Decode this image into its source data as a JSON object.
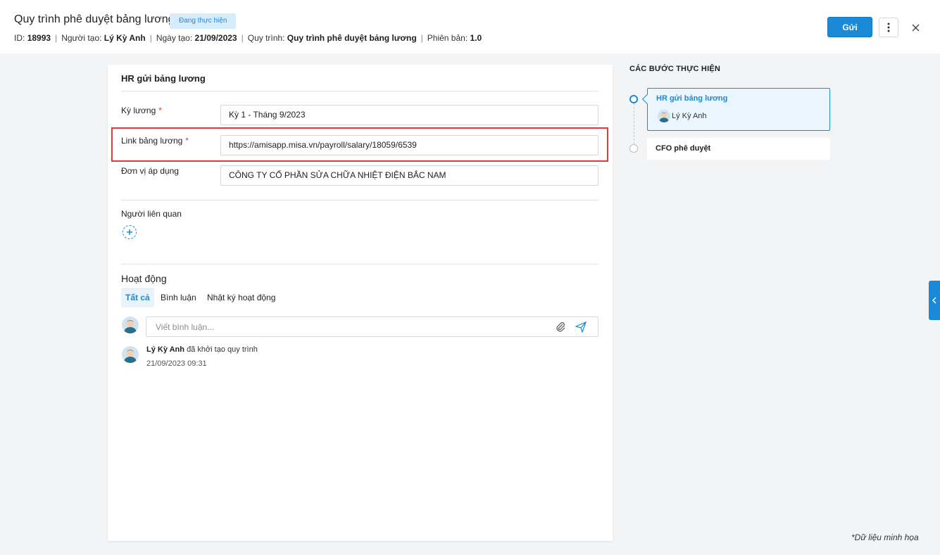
{
  "header": {
    "title": "Quy trình phê duyệt bảng lương",
    "status": "Đang thực hiện",
    "meta": {
      "id_label": "ID:",
      "id_value": "18993",
      "creator_label": "Người tạo:",
      "creator_value": "Lý Kỳ Anh",
      "date_label": "Ngày tạo:",
      "date_value": "21/09/2023",
      "process_label": "Quy trình:",
      "process_value": "Quy trình phê duyệt bảng lương",
      "version_label": "Phiên bản:",
      "version_value": "1.0"
    },
    "send_label": "Gửi"
  },
  "form": {
    "section_title": "HR gửi bảng lương",
    "fields": [
      {
        "label": "Kỳ lương",
        "required": "*",
        "value": "Kỳ 1 - Tháng 9/2023"
      },
      {
        "label": "Link bảng lương",
        "required": "*",
        "value": "https://amisapp.misa.vn/payroll/salary/18059/6539"
      },
      {
        "label": "Đơn vị áp dụng",
        "value": "CÔNG TY CỔ PHẦN SỬA CHỮA NHIỆT ĐIỆN BẮC NAM"
      }
    ],
    "related_label": "Người liên quan"
  },
  "activity": {
    "title": "Hoạt động",
    "tabs": [
      "Tất cả",
      "Bình luận",
      "Nhật ký hoạt động"
    ],
    "comment_placeholder": "Viết bình luận...",
    "entries": [
      {
        "user": "Lý Kỳ Anh",
        "action": "đã khởi tạo quy trình",
        "time": "21/09/2023 09:31"
      }
    ]
  },
  "steps": {
    "title": "CÁC BƯỚC THỰC HIỆN",
    "items": [
      {
        "name": "HR gửi bảng lương",
        "user": "Lý Kỳ Anh"
      },
      {
        "name": "CFO phê duyệt"
      }
    ]
  },
  "footnote": "*Dữ liệu minh họa",
  "colors": {
    "accent": "#1a8ad8",
    "required": "#e53935",
    "status_bg": "#d6ecfb"
  },
  "icons": [
    "more-vertical-icon",
    "close-icon",
    "plus-icon",
    "paperclip-icon",
    "send-icon",
    "chevron-left-icon"
  ]
}
